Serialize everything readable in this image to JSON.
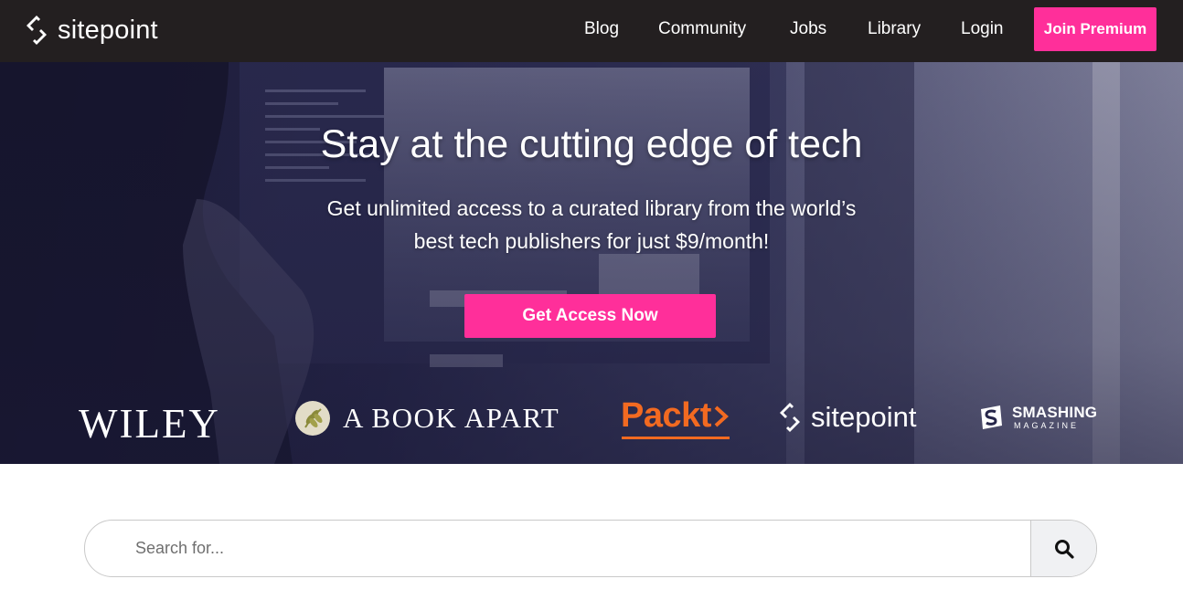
{
  "header": {
    "brand": "sitepoint",
    "nav": [
      "Blog",
      "Community",
      "Jobs",
      "Library",
      "Login"
    ],
    "join_label": "Join Premium"
  },
  "hero": {
    "title": "Stay at the cutting edge of tech",
    "subtitle_line1": "Get unlimited access to a curated library from the world’s",
    "subtitle_line2": "best tech publishers for just $9/month!",
    "cta_label": "Get Access Now"
  },
  "publishers": {
    "wiley": "WILEY",
    "a_book_apart": "A BOOK APART",
    "packt": "Packt",
    "sitepoint": "sitepoint",
    "smashing": "SMASHING",
    "smashing_sub": "MAGAZINE"
  },
  "search": {
    "placeholder": "Search for..."
  },
  "colors": {
    "accent": "#ff2f9a",
    "topbar": "#231f20",
    "packt": "#f26a21"
  },
  "icons": [
    "sitepoint-logo-icon",
    "laurel-icon",
    "smashing-s-icon",
    "search-icon"
  ]
}
